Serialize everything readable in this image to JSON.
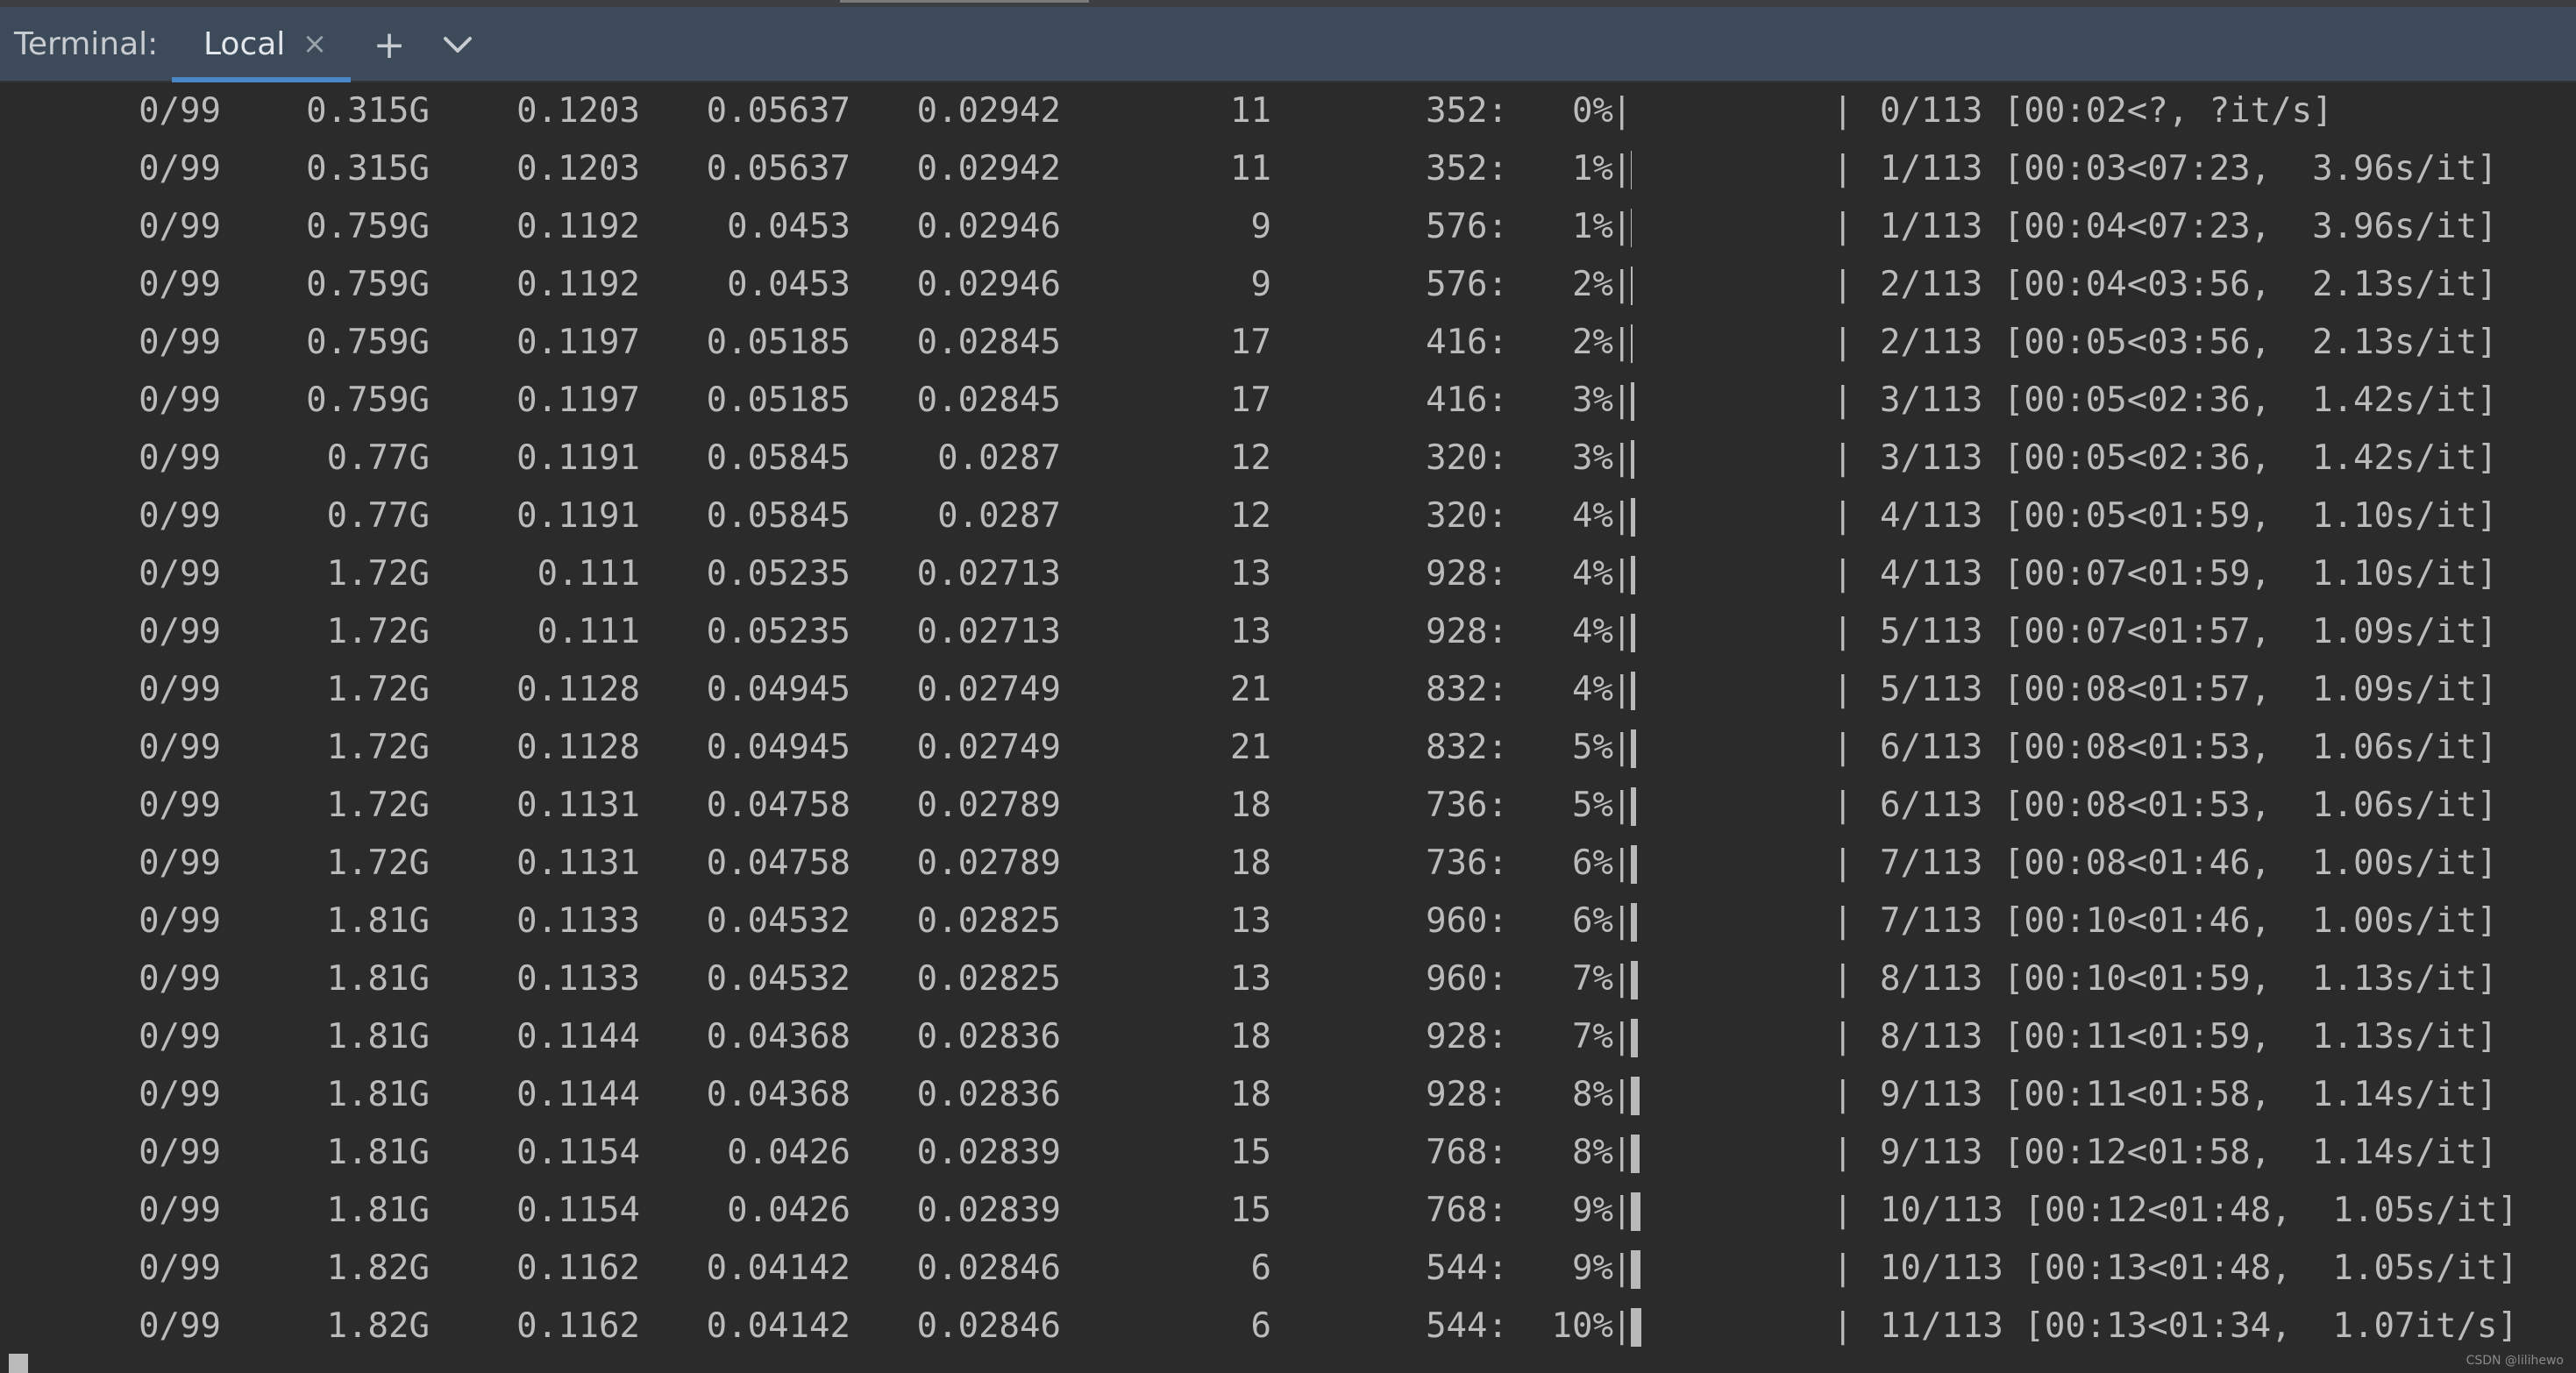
{
  "tab_bar": {
    "title": "Terminal:",
    "tabs": [
      {
        "label": "Local",
        "active": true,
        "close_glyph": "×"
      }
    ],
    "new_tab_glyph": "+",
    "options_glyph": "⌄"
  },
  "terminal": {
    "rows": [
      {
        "epoch": "0/99",
        "gpu_mem": "0.315G",
        "box": "0.1203",
        "obj": "0.05637",
        "cls": "0.02942",
        "labels": "11",
        "img_size": "352:",
        "percent": "0%",
        "progress_text": "0/113 [00:02<?, ?it/s]",
        "bar_fraction": 0.0
      },
      {
        "epoch": "0/99",
        "gpu_mem": "0.315G",
        "box": "0.1203",
        "obj": "0.05637",
        "cls": "0.02942",
        "labels": "11",
        "img_size": "352:",
        "percent": "1%",
        "progress_text": "1/113 [00:03<07:23,  3.96s/it]",
        "bar_fraction": 0.01
      },
      {
        "epoch": "0/99",
        "gpu_mem": "0.759G",
        "box": "0.1192",
        "obj": "0.0453",
        "cls": "0.02946",
        "labels": "9",
        "img_size": "576:",
        "percent": "1%",
        "progress_text": "1/113 [00:04<07:23,  3.96s/it]",
        "bar_fraction": 0.01
      },
      {
        "epoch": "0/99",
        "gpu_mem": "0.759G",
        "box": "0.1192",
        "obj": "0.0453",
        "cls": "0.02946",
        "labels": "9",
        "img_size": "576:",
        "percent": "2%",
        "progress_text": "2/113 [00:04<03:56,  2.13s/it]",
        "bar_fraction": 0.02
      },
      {
        "epoch": "0/99",
        "gpu_mem": "0.759G",
        "box": "0.1197",
        "obj": "0.05185",
        "cls": "0.02845",
        "labels": "17",
        "img_size": "416:",
        "percent": "2%",
        "progress_text": "2/113 [00:05<03:56,  2.13s/it]",
        "bar_fraction": 0.02
      },
      {
        "epoch": "0/99",
        "gpu_mem": "0.759G",
        "box": "0.1197",
        "obj": "0.05185",
        "cls": "0.02845",
        "labels": "17",
        "img_size": "416:",
        "percent": "3%",
        "progress_text": "3/113 [00:05<02:36,  1.42s/it]",
        "bar_fraction": 0.03
      },
      {
        "epoch": "0/99",
        "gpu_mem": "0.77G",
        "box": "0.1191",
        "obj": "0.05845",
        "cls": "0.0287",
        "labels": "12",
        "img_size": "320:",
        "percent": "3%",
        "progress_text": "3/113 [00:05<02:36,  1.42s/it]",
        "bar_fraction": 0.03
      },
      {
        "epoch": "0/99",
        "gpu_mem": "0.77G",
        "box": "0.1191",
        "obj": "0.05845",
        "cls": "0.0287",
        "labels": "12",
        "img_size": "320:",
        "percent": "4%",
        "progress_text": "4/113 [00:05<01:59,  1.10s/it]",
        "bar_fraction": 0.04
      },
      {
        "epoch": "0/99",
        "gpu_mem": "1.72G",
        "box": "0.111",
        "obj": "0.05235",
        "cls": "0.02713",
        "labels": "13",
        "img_size": "928:",
        "percent": "4%",
        "progress_text": "4/113 [00:07<01:59,  1.10s/it]",
        "bar_fraction": 0.04
      },
      {
        "epoch": "0/99",
        "gpu_mem": "1.72G",
        "box": "0.111",
        "obj": "0.05235",
        "cls": "0.02713",
        "labels": "13",
        "img_size": "928:",
        "percent": "4%",
        "progress_text": "5/113 [00:07<01:57,  1.09s/it]",
        "bar_fraction": 0.04
      },
      {
        "epoch": "0/99",
        "gpu_mem": "1.72G",
        "box": "0.1128",
        "obj": "0.04945",
        "cls": "0.02749",
        "labels": "21",
        "img_size": "832:",
        "percent": "4%",
        "progress_text": "5/113 [00:08<01:57,  1.09s/it]",
        "bar_fraction": 0.04
      },
      {
        "epoch": "0/99",
        "gpu_mem": "1.72G",
        "box": "0.1128",
        "obj": "0.04945",
        "cls": "0.02749",
        "labels": "21",
        "img_size": "832:",
        "percent": "5%",
        "progress_text": "6/113 [00:08<01:53,  1.06s/it]",
        "bar_fraction": 0.05
      },
      {
        "epoch": "0/99",
        "gpu_mem": "1.72G",
        "box": "0.1131",
        "obj": "0.04758",
        "cls": "0.02789",
        "labels": "18",
        "img_size": "736:",
        "percent": "5%",
        "progress_text": "6/113 [00:08<01:53,  1.06s/it]",
        "bar_fraction": 0.05
      },
      {
        "epoch": "0/99",
        "gpu_mem": "1.72G",
        "box": "0.1131",
        "obj": "0.04758",
        "cls": "0.02789",
        "labels": "18",
        "img_size": "736:",
        "percent": "6%",
        "progress_text": "7/113 [00:08<01:46,  1.00s/it]",
        "bar_fraction": 0.06
      },
      {
        "epoch": "0/99",
        "gpu_mem": "1.81G",
        "box": "0.1133",
        "obj": "0.04532",
        "cls": "0.02825",
        "labels": "13",
        "img_size": "960:",
        "percent": "6%",
        "progress_text": "7/113 [00:10<01:46,  1.00s/it]",
        "bar_fraction": 0.06
      },
      {
        "epoch": "0/99",
        "gpu_mem": "1.81G",
        "box": "0.1133",
        "obj": "0.04532",
        "cls": "0.02825",
        "labels": "13",
        "img_size": "960:",
        "percent": "7%",
        "progress_text": "8/113 [00:10<01:59,  1.13s/it]",
        "bar_fraction": 0.07
      },
      {
        "epoch": "0/99",
        "gpu_mem": "1.81G",
        "box": "0.1144",
        "obj": "0.04368",
        "cls": "0.02836",
        "labels": "18",
        "img_size": "928:",
        "percent": "7%",
        "progress_text": "8/113 [00:11<01:59,  1.13s/it]",
        "bar_fraction": 0.07
      },
      {
        "epoch": "0/99",
        "gpu_mem": "1.81G",
        "box": "0.1144",
        "obj": "0.04368",
        "cls": "0.02836",
        "labels": "18",
        "img_size": "928:",
        "percent": "8%",
        "progress_text": "9/113 [00:11<01:58,  1.14s/it]",
        "bar_fraction": 0.08
      },
      {
        "epoch": "0/99",
        "gpu_mem": "1.81G",
        "box": "0.1154",
        "obj": "0.0426",
        "cls": "0.02839",
        "labels": "15",
        "img_size": "768:",
        "percent": "8%",
        "progress_text": "9/113 [00:12<01:58,  1.14s/it]",
        "bar_fraction": 0.08
      },
      {
        "epoch": "0/99",
        "gpu_mem": "1.81G",
        "box": "0.1154",
        "obj": "0.0426",
        "cls": "0.02839",
        "labels": "15",
        "img_size": "768:",
        "percent": "9%",
        "progress_text": "10/113 [00:12<01:48,  1.05s/it]",
        "bar_fraction": 0.09
      },
      {
        "epoch": "0/99",
        "gpu_mem": "1.82G",
        "box": "0.1162",
        "obj": "0.04142",
        "cls": "0.02846",
        "labels": "6",
        "img_size": "544:",
        "percent": "9%",
        "progress_text": "10/113 [00:13<01:48,  1.05s/it]",
        "bar_fraction": 0.09
      },
      {
        "epoch": "0/99",
        "gpu_mem": "1.82G",
        "box": "0.1162",
        "obj": "0.04142",
        "cls": "0.02846",
        "labels": "6",
        "img_size": "544:",
        "percent": "10%",
        "progress_text": "11/113 [00:13<01:34,  1.07it/s]",
        "bar_fraction": 0.1
      }
    ]
  },
  "watermark": "CSDN @lilihewo",
  "colors": {
    "background": "#2b2b2b",
    "text": "#bbbbbb",
    "tab_bar": "#3c4a5a",
    "tab_underline": "#4a88c7",
    "progress_bar": "#b9b9b9"
  }
}
